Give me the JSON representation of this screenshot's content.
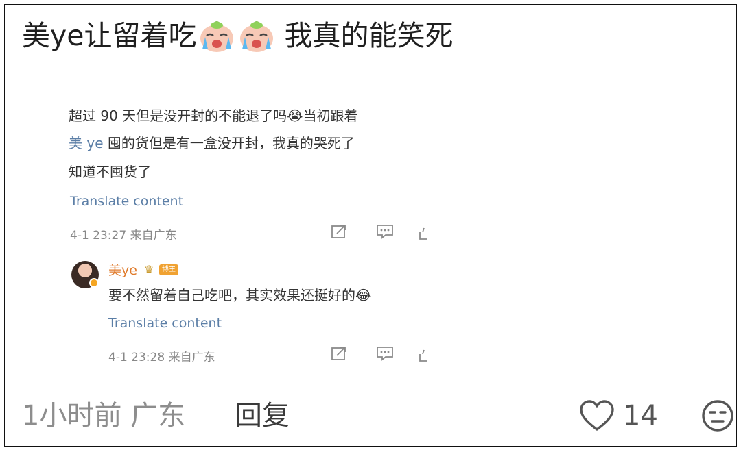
{
  "post": {
    "title_before": "美ye让留着吃",
    "title_after": "我真的能笑死",
    "emoji_icon": "crying-face-icon"
  },
  "embedded": {
    "comment": {
      "line1": "超过 90 天但是没开封的不能退了吗😭当初跟着",
      "mention": "美 ye",
      "line2_rest": " 囤的货但是有一盒没开封，我真的哭死了",
      "line3": "知道不囤货了",
      "translate": "Translate content",
      "meta": "4-1 23:27 来自广东"
    },
    "reply": {
      "name": "美ye",
      "badge": "博主",
      "text": "要不然留着自己吃吧，其实效果还挺好的😂",
      "translate": "Translate content",
      "meta": "4-1 23:28 来自广东"
    }
  },
  "footer": {
    "time": "1小时前 广东",
    "reply_label": "回复",
    "likes": "14"
  },
  "colors": {
    "link": "#5b7ea6",
    "username_orange": "#e07b2c",
    "badge": "#f0a232"
  }
}
